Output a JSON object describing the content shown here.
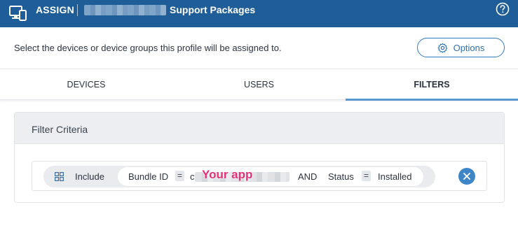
{
  "header": {
    "app_icon": "monitor-phone-icon",
    "assign_label": "ASSIGN",
    "title": "Support Packages",
    "help_icon": "help-circle-icon",
    "color": "#1f5d99"
  },
  "subheader": {
    "description": "Select the devices or device groups this profile will be assigned to.",
    "options_label": "Options",
    "options_icon": "gear-icon"
  },
  "tabs": [
    {
      "label": "DEVICES",
      "active": false
    },
    {
      "label": "USERS",
      "active": false
    },
    {
      "label": "FILTERS",
      "active": true
    }
  ],
  "filter_panel": {
    "title": "Filter Criteria",
    "rule": {
      "mode_icon": "grid-icon",
      "mode": "Include",
      "field1": "Bundle ID",
      "operator1": "=",
      "value1_visible_prefix": "c",
      "annotation": "Your app",
      "conjunction": "AND",
      "field2": "Status",
      "operator2": "=",
      "value2": "Installed"
    },
    "remove_icon": "close-icon"
  }
}
